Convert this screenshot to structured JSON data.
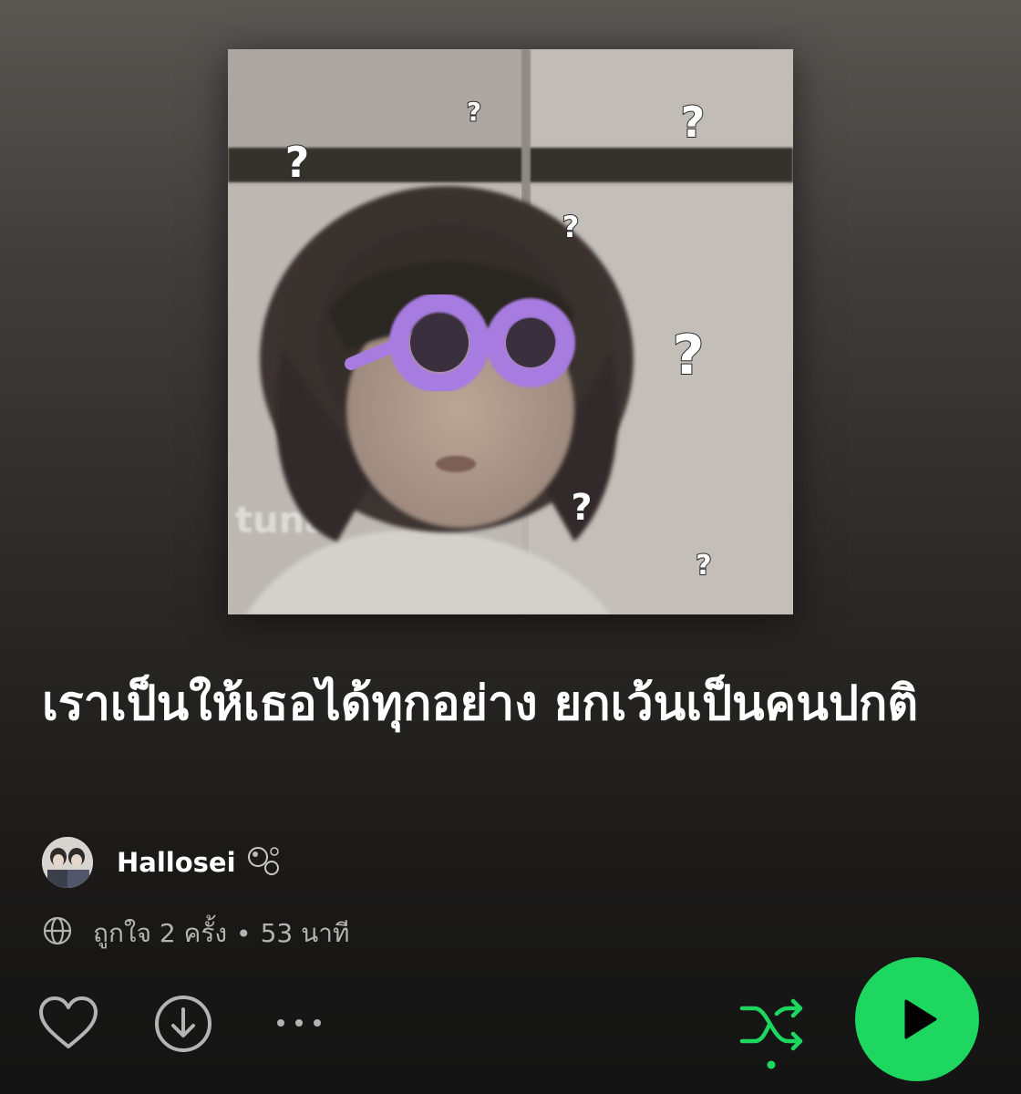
{
  "playlist": {
    "title": "เราเป็นให้เธอได้ทุกอย่าง ยกเว้นเป็นคนปกติ",
    "owner": "Hallosei",
    "likes": "ถูกใจ 2 ครั้ง",
    "separator": "•",
    "duration": "53 นาที"
  },
  "cover": {
    "icon": "playlist-cover-image",
    "question_marks": [
      "?",
      "?",
      "?",
      "?",
      "?",
      "?",
      "?"
    ]
  },
  "actions": {
    "like_icon": "heart-outline-icon",
    "download_icon": "download-circle-icon",
    "more_icon": "more-options-icon",
    "shuffle_icon": "shuffle-icon",
    "play_icon": "play-icon"
  },
  "colors": {
    "accent": "#1ed760",
    "text_primary": "#ffffff",
    "text_secondary": "#b3b3b3",
    "glasses": "#a77be0"
  }
}
